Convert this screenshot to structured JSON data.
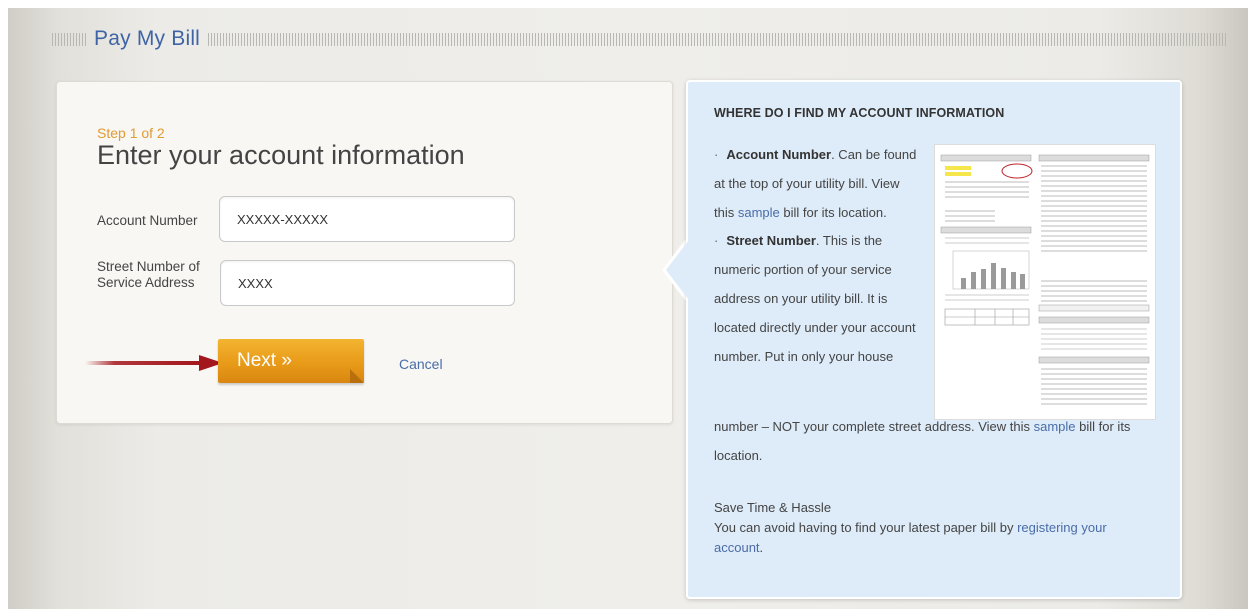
{
  "header": {
    "title": "Pay My Bill"
  },
  "form": {
    "step": "Step 1 of 2",
    "heading": "Enter your account information",
    "account_label": "Account Number",
    "account_value": "XXXXX-XXXXX",
    "street_label_line1": "Street Number of",
    "street_label_line2": "Service Address",
    "street_value": "XXXX",
    "next_label": "Next »",
    "cancel_label": "Cancel"
  },
  "info": {
    "heading": "WHERE DO I FIND MY ACCOUNT INFORMATION",
    "bullet": "·",
    "account_term": "Account Number",
    "account_text_a": ". Can be found at the top of your utility bill. View this ",
    "account_link": "sample",
    "account_text_b": " bill for its location.",
    "street_term": "Street Number",
    "street_text_a": ". This is the numeric portion of your service address on your utility bill. It is located directly under your account number. Put in only your house",
    "street_text_b": "number – NOT your complete street address. View this ",
    "street_link": "sample",
    "street_text_c": " bill for its location.",
    "save_title": "Save Time & Hassle",
    "save_text": "You can avoid having to find your latest paper bill by ",
    "save_link": "registering your account",
    "save_end": "."
  },
  "colors": {
    "accent_orange": "#e89a19",
    "title_blue": "#3f64a6",
    "link_blue": "#4a6da8",
    "info_bg": "#deebf8",
    "arrow_red": "#a3161b",
    "step_orange": "#e09b33"
  },
  "icons": {
    "pointer_arrow": "red-arrow-icon",
    "sample_bill": "sample-bill-image"
  }
}
